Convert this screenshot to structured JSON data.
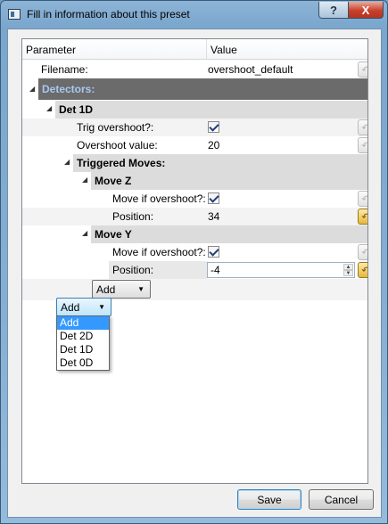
{
  "window": {
    "title": "Fill in information about this preset",
    "help_label": "?",
    "close_label": "X"
  },
  "tree": {
    "header": {
      "parameter": "Parameter",
      "value": "Value"
    },
    "rows": {
      "filename": {
        "label": "Filename:",
        "value": "overshoot_default"
      },
      "detectors": {
        "label": "Detectors:"
      },
      "det1d": {
        "label": "Det 1D"
      },
      "trig": {
        "label": "Trig overshoot?:",
        "checked": true
      },
      "overshoot": {
        "label": "Overshoot value:",
        "value": "20"
      },
      "triggered": {
        "label": "Triggered Moves:"
      },
      "movez": {
        "label": "Move Z"
      },
      "movez_if": {
        "label": "Move if overshoot?:",
        "checked": true
      },
      "movez_pos": {
        "label": "Position:",
        "value": "34"
      },
      "movey": {
        "label": "Move Y"
      },
      "movey_if": {
        "label": "Move if overshoot?:",
        "checked": true
      },
      "movey_pos": {
        "label": "Position:",
        "value": "-4"
      }
    },
    "add_combo_inner": "Add",
    "add_combo_outer": "Add"
  },
  "dropdown": {
    "options": [
      "Add",
      "Det 2D",
      "Det 1D",
      "Det 0D"
    ],
    "selected": "Add"
  },
  "buttons": {
    "save": "Save",
    "cancel": "Cancel"
  },
  "icons": {
    "reset": "reset-arrow-icon",
    "expand": "expanded-triangle-icon"
  },
  "colors": {
    "selection": "#3399ff",
    "group_dark": "#6b6b6b",
    "group_light": "#dcdcdc",
    "detectors_text": "#a8c8f0"
  }
}
